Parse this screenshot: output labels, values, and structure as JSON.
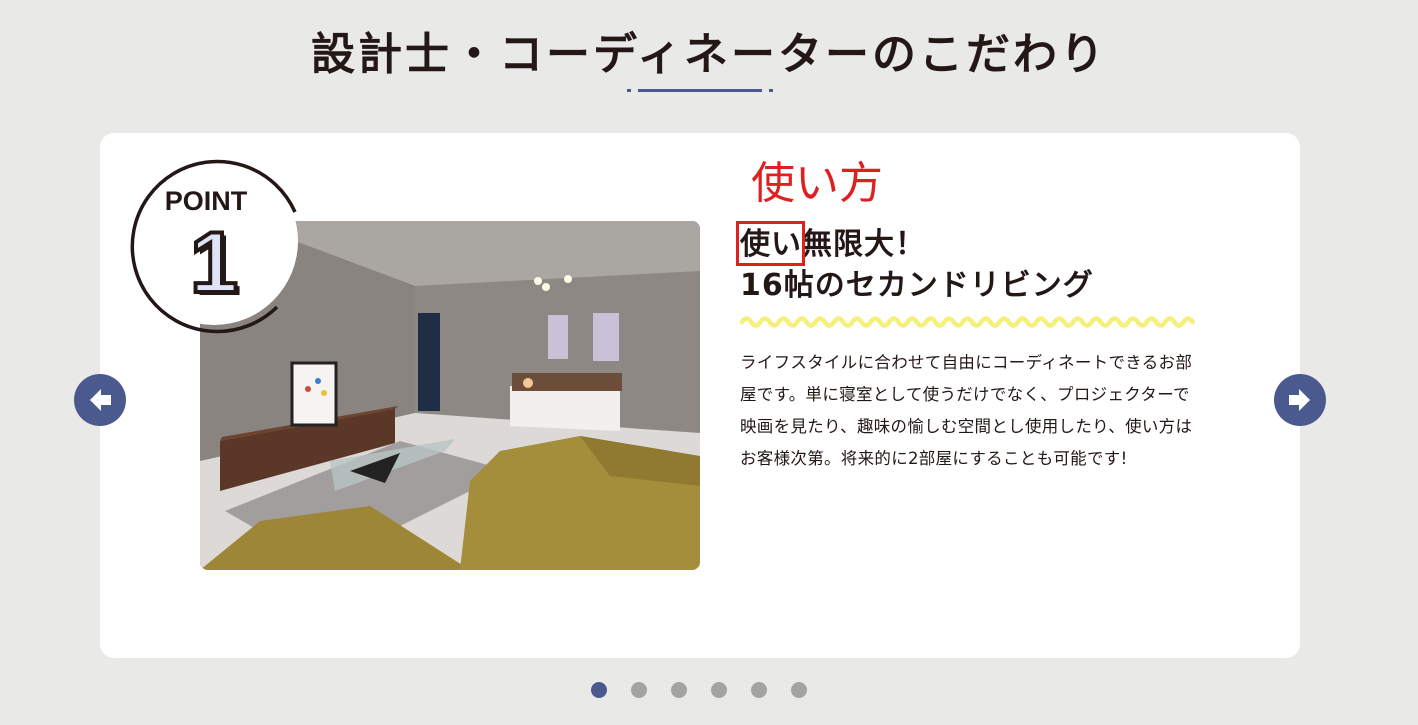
{
  "section": {
    "title": "設計士・コーディネーターのこだわり"
  },
  "slide": {
    "point_label": "POINT",
    "point_number": "1",
    "annotation": "使い方",
    "heading_highlight": "使い",
    "heading_rest": "無限大！",
    "heading_line2": "16帖のセカンドリビング",
    "description": "ライフスタイルに合わせて自由にコーディネートできるお部屋です。単に寝室として使うだけでなく、プロジェクターで映画を見たり、趣味の愉しむ空間とし使用したり、使い方はお客様次第。将来的に2部屋にすることも可能です!",
    "image": "room-photo"
  },
  "navigation": {
    "prev_icon": "arrow-left-icon",
    "next_icon": "arrow-right-icon"
  },
  "pagination": {
    "total": 6,
    "active_index": 0
  },
  "colors": {
    "accent": "#4b5a8e",
    "annotation_red": "#e02020",
    "wave_yellow": "#f5f07a",
    "background": "#e9e9e7",
    "dot_inactive": "#a3a3a3"
  }
}
